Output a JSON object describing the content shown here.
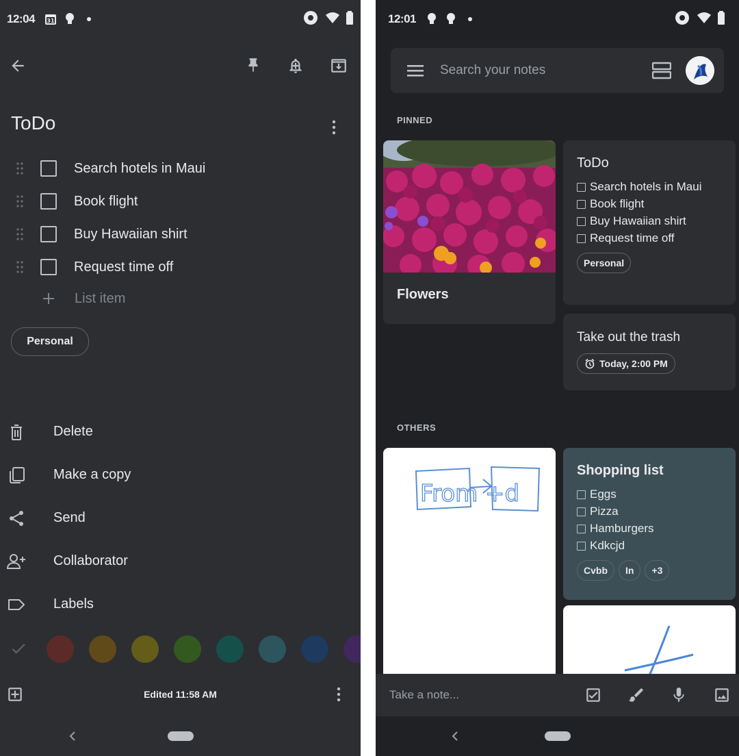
{
  "left": {
    "status": {
      "time": "12:04"
    },
    "note": {
      "title": "ToDo",
      "items": [
        {
          "label": "Search hotels in Maui"
        },
        {
          "label": "Book flight"
        },
        {
          "label": "Buy Hawaiian shirt"
        },
        {
          "label": "Request time off"
        }
      ],
      "add_placeholder": "List item",
      "label_chip": "Personal"
    },
    "menu": [
      {
        "label": "Delete",
        "icon": "trash-icon"
      },
      {
        "label": "Make a copy",
        "icon": "copy-icon"
      },
      {
        "label": "Send",
        "icon": "share-icon"
      },
      {
        "label": "Collaborator",
        "icon": "person-add-icon"
      },
      {
        "label": "Labels",
        "icon": "label-icon"
      }
    ],
    "colors": [
      "#5c2b29",
      "#614a19",
      "#635d19",
      "#345920",
      "#16504b",
      "#2d555e",
      "#1e3a5f",
      "#42275e"
    ],
    "edited": "Edited 11:58 AM"
  },
  "right": {
    "status": {
      "time": "12:01"
    },
    "search_placeholder": "Search your notes",
    "pinned_label": "PINNED",
    "others_label": "OTHERS",
    "flowers_card": {
      "title": "Flowers"
    },
    "todo_card": {
      "title": "ToDo",
      "items": [
        "Search hotels in Maui",
        "Book flight",
        "Buy Hawaiian shirt",
        "Request time off"
      ],
      "chip": "Personal"
    },
    "trash_card": {
      "title": "Take out the trash",
      "reminder": "Today, 2:00 PM"
    },
    "shopping_card": {
      "title": "Shopping list",
      "items": [
        "Eggs",
        "Pizza",
        "Hamburgers",
        "Kdkcjd"
      ],
      "chips": [
        "Cvbb",
        "In",
        "+3"
      ],
      "color": "#3c4f56"
    },
    "drawing_text": "From +d",
    "take_note": "Take a note..."
  }
}
